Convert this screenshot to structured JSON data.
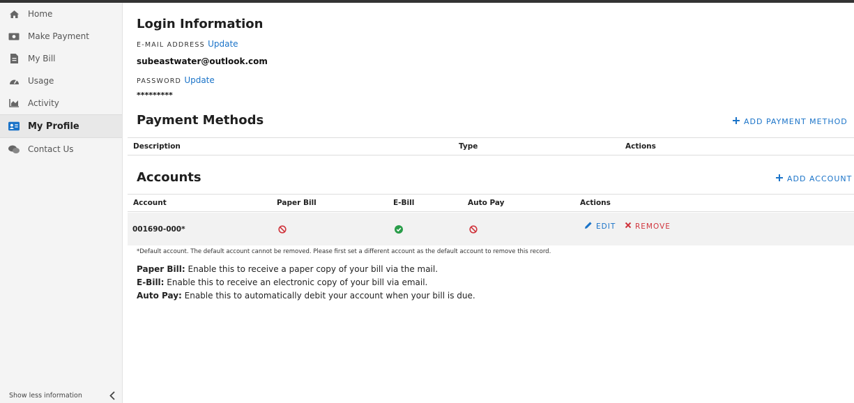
{
  "sidebar": {
    "items": [
      {
        "label": "Home",
        "icon": "home-icon"
      },
      {
        "label": "Make Payment",
        "icon": "money-icon"
      },
      {
        "label": "My Bill",
        "icon": "bill-icon"
      },
      {
        "label": "Usage",
        "icon": "gauge-icon"
      },
      {
        "label": "Activity",
        "icon": "chart-icon"
      },
      {
        "label": "My Profile",
        "icon": "profile-card-icon",
        "active": true
      },
      {
        "label": "Contact Us",
        "icon": "chat-icon"
      }
    ],
    "footer": "Show less information"
  },
  "login": {
    "title": "Login Information",
    "email_label": "E-MAIL ADDRESS",
    "email_update": "Update",
    "email_value": "subeastwater@outlook.com",
    "password_label": "PASSWORD",
    "password_update": "Update",
    "password_value": "*********"
  },
  "payment_methods": {
    "title": "Payment Methods",
    "add_label": "ADD PAYMENT METHOD",
    "columns": [
      "Description",
      "Type",
      "Actions"
    ]
  },
  "accounts": {
    "title": "Accounts",
    "add_label": "ADD ACCOUNT",
    "columns": [
      "Account",
      "Paper Bill",
      "E-Bill",
      "Auto Pay",
      "Actions"
    ],
    "rows": [
      {
        "account": "001690-000*",
        "paper_bill": false,
        "e_bill": true,
        "auto_pay": false,
        "edit_label": "EDIT",
        "remove_label": "REMOVE"
      }
    ],
    "note": "*Default account. The default account cannot be removed. Please first set a different account as the default account to remove this record."
  },
  "legend": [
    {
      "term": "Paper Bill:",
      "desc": " Enable this to receive a paper copy of your bill via the mail."
    },
    {
      "term": "E-Bill:",
      "desc": " Enable this to receive an electronic copy of your bill via email."
    },
    {
      "term": "Auto Pay:",
      "desc": " Enable this to automatically debit your account when your bill is due."
    }
  ],
  "colors": {
    "accent": "#1a73c8",
    "danger": "#d0343c",
    "success": "#2a9d4a"
  }
}
